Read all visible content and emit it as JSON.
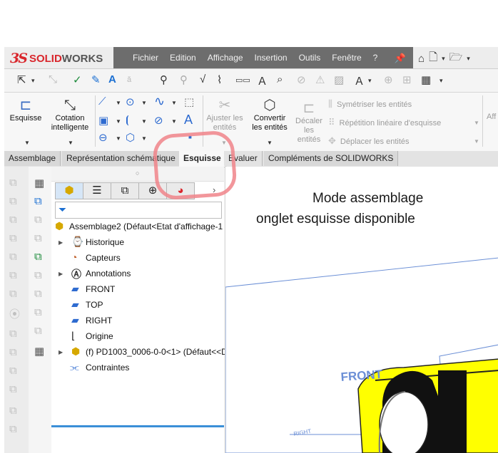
{
  "app": {
    "logo_mark": "3S",
    "logo_text_a": "SOLID",
    "logo_text_b": "WORKS"
  },
  "menu": {
    "items": [
      "Fichier",
      "Edition",
      "Affichage",
      "Insertion",
      "Outils",
      "Fenêtre",
      "?"
    ]
  },
  "command_manager": {
    "esquisse_label": "Esquisse",
    "cotation_label_1": "Cotation",
    "cotation_label_2": "intelligente",
    "ajuster_label_1": "Ajuster les",
    "ajuster_label_2": "entités",
    "convertir_label_1": "Convertir",
    "convertir_label_2": "les entités",
    "decaler_label_1": "Décaler",
    "decaler_label_2": "les",
    "decaler_label_3": "entités",
    "symetriser_label": "Symétriser les entités",
    "repetition_label": "Répétition linéaire d'esquisse",
    "deplacer_label": "Déplacer les entités",
    "clipped_label": "Aff"
  },
  "tabs": [
    {
      "label": "Assemblage"
    },
    {
      "label": "Représentation schématique"
    },
    {
      "label": "Esquisse"
    },
    {
      "label": "Evaluer"
    },
    {
      "label": "Compléments de SOLIDWORKS"
    }
  ],
  "feature_tree": {
    "root": "Assemblage2  (Défaut<Etat d'affichage-1",
    "items": [
      "Historique",
      "Capteurs",
      "Annotations",
      "FRONT",
      "TOP",
      "RIGHT",
      "Origine",
      "(f) PD1003_0006-0-0<1> (Défaut<<D",
      "Contraintes"
    ]
  },
  "graphics": {
    "annotation_line1": "Mode assemblage",
    "annotation_line2": "onglet esquisse disponible",
    "plane_label": "FRONT",
    "plane_label_small": "RIGHT"
  },
  "colors": {
    "brand_red": "#d9262c",
    "menubar_bg": "#6d6d6d",
    "highlight_ring": "#f0848a",
    "plane_blue": "#6b8fd6",
    "part_yellow": "#ffff00",
    "tree_selection_bar": "#3b8fd7"
  }
}
